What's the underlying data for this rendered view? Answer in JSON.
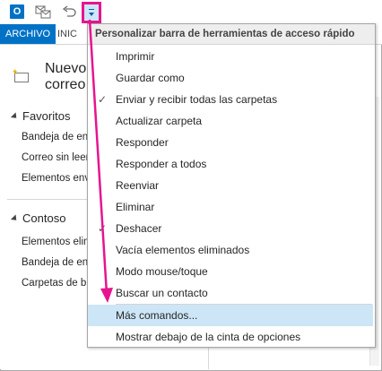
{
  "qat": {
    "logo_text": "O",
    "icons": [
      "outlook-logo",
      "send-receive-icon",
      "undo-icon",
      "customize-qat-dropdown-icon"
    ]
  },
  "ribbon": {
    "file_tab": "ARCHIVO",
    "home_tab": "INIC"
  },
  "left_pane": {
    "new_mail": "Nuevo correo",
    "favorites_header": "Favoritos",
    "favorites": [
      "Bandeja de en",
      "Correo sin leer",
      "Elementos env"
    ],
    "account_header": "Contoso",
    "account_folders": [
      "Elementos elim",
      "Bandeja de en",
      "Carpetas de b"
    ]
  },
  "dropdown": {
    "title": "Personalizar barra de herramientas de acceso rápido",
    "items": [
      {
        "label": "Imprimir",
        "checked": false
      },
      {
        "label": "Guardar como",
        "checked": false
      },
      {
        "label": "Enviar y recibir todas las carpetas",
        "checked": true
      },
      {
        "label": "Actualizar carpeta",
        "checked": false
      },
      {
        "label": "Responder",
        "checked": false
      },
      {
        "label": "Responder a todos",
        "checked": false
      },
      {
        "label": "Reenviar",
        "checked": false
      },
      {
        "label": "Eliminar",
        "checked": false
      },
      {
        "label": "Deshacer",
        "checked": true
      },
      {
        "label": "Vacía elementos eliminados",
        "checked": false
      },
      {
        "label": "Modo mouse/toque",
        "checked": false
      },
      {
        "label": "Buscar un contacto",
        "checked": false
      }
    ],
    "more_commands": "Más comandos...",
    "show_below": "Mostrar debajo de la cinta de opciones",
    "check_glyph": "✓"
  },
  "colors": {
    "accent": "#0072c6",
    "highlight": "#cde6f7",
    "callout": "#e6158f"
  }
}
